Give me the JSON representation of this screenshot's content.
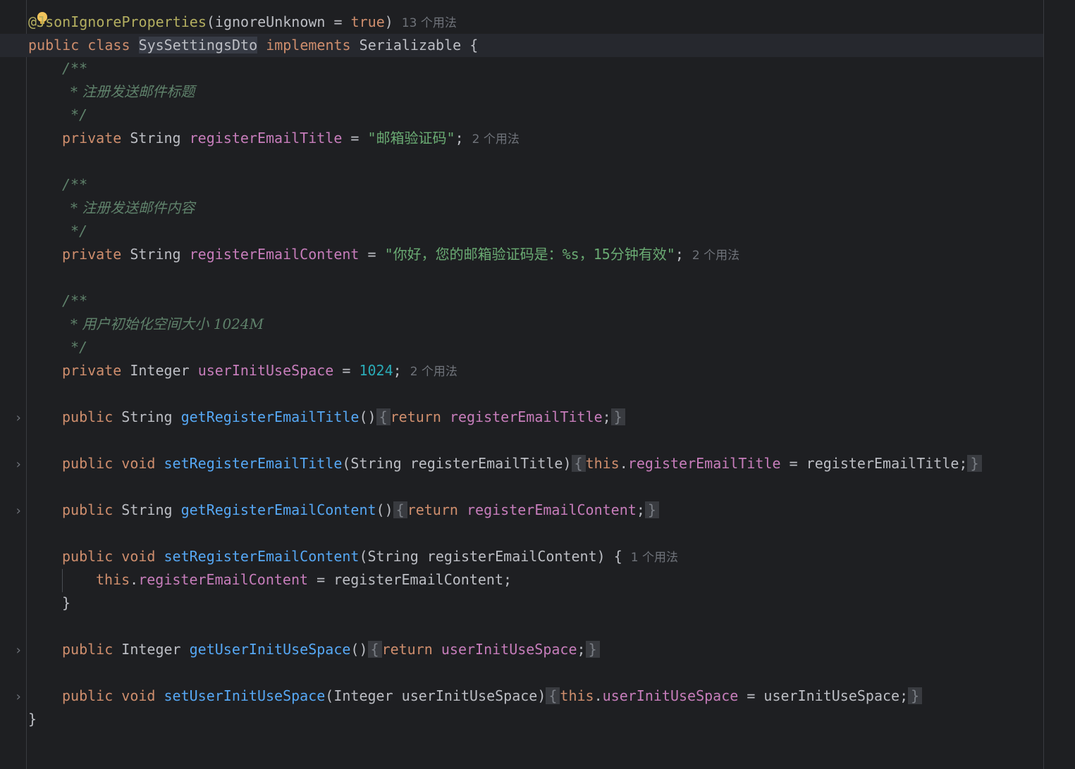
{
  "editor": {
    "lines": {
      "l1": {
        "at": "@",
        "ann_name": "JsonIgnoreProperties",
        "open": "(",
        "param": "ignoreUnknown",
        "eq": " = ",
        "val": "true",
        "close": ")",
        "hint": "13 个用法"
      },
      "l2": {
        "kw1": "public",
        "kw2": "class",
        "name": "SysSettingsDto",
        "kw3": "implements",
        "iface": "Serializable",
        "brace": "{"
      },
      "c1_open": "/**",
      "c1_text": "* 注册发送邮件标题",
      "c1_close": "*/",
      "f1": {
        "kw": "private",
        "type": "String",
        "name": "registerEmailTitle",
        "eq": " = ",
        "val": "\"邮箱验证码\"",
        "semi": ";",
        "hint": "2 个用法"
      },
      "c2_open": "/**",
      "c2_text": "* 注册发送邮件内容",
      "c2_close": "*/",
      "f2": {
        "kw": "private",
        "type": "String",
        "name": "registerEmailContent",
        "eq": " = ",
        "val": "\"你好，您的邮箱验证码是：%s，15分钟有效\"",
        "semi": ";",
        "hint": "2 个用法"
      },
      "c3_open": "/**",
      "c3_text": "* 用户初始化空间大小 1024M",
      "c3_close": "*/",
      "f3": {
        "kw": "private",
        "type": "Integer",
        "name": "userInitUseSpace",
        "eq": " = ",
        "val": "1024",
        "semi": ";",
        "hint": "2 个用法"
      },
      "m1": {
        "kw": "public",
        "type": "String",
        "name": "getRegisterEmailTitle",
        "params": "()",
        "lb": "{",
        "ret": "return",
        "field": "registerEmailTitle",
        "semi": ";",
        "rb": "}"
      },
      "m2": {
        "kw": "public",
        "type": "void",
        "name": "setRegisterEmailTitle",
        "params_open": "(String ",
        "param": "registerEmailTitle",
        "params_close": ")",
        "lb": "{",
        "this": "this",
        "dot": ".",
        "field": "registerEmailTitle",
        "eq": " = ",
        "rhs": "registerEmailTitle",
        "semi": ";",
        "rb": "}"
      },
      "m3": {
        "kw": "public",
        "type": "String",
        "name": "getRegisterEmailContent",
        "params": "()",
        "lb": "{",
        "ret": "return",
        "field": "registerEmailContent",
        "semi": ";",
        "rb": "}"
      },
      "m4": {
        "kw": "public",
        "type": "void",
        "name": "setRegisterEmailContent",
        "params": "(String registerEmailContent)",
        "lb": "{",
        "hint": "1 个用法"
      },
      "m4_body": {
        "this": "this",
        "dot": ".",
        "field": "registerEmailContent",
        "eq": " = ",
        "rhs": "registerEmailContent;"
      },
      "m4_close": "}",
      "m5": {
        "kw": "public",
        "type": "Integer",
        "name": "getUserInitUseSpace",
        "params": "()",
        "lb": "{",
        "ret": "return",
        "field": "userInitUseSpace",
        "semi": ";",
        "rb": "}"
      },
      "m6": {
        "kw": "public",
        "type": "void",
        "name": "setUserInitUseSpace",
        "params": "(Integer userInitUseSpace)",
        "lb": "{",
        "this": "this",
        "dot": ".",
        "field": "userInitUseSpace",
        "eq": " = ",
        "rhs": "userInitUseSpace",
        "semi": ";",
        "rb": "}"
      },
      "end": "}"
    },
    "fold_arrow": "›"
  },
  "colors": {
    "background": "#1e1f22",
    "keyword": "#cf8e6d",
    "annotation": "#b3ae60",
    "field": "#c77dbb",
    "string": "#6aab73",
    "number": "#2aacb8",
    "method": "#56a8f5",
    "doc_comment": "#5f826b",
    "hint": "#6f737a"
  },
  "icons": [
    "lightbulb-icon",
    "fold-arrow-icon"
  ]
}
